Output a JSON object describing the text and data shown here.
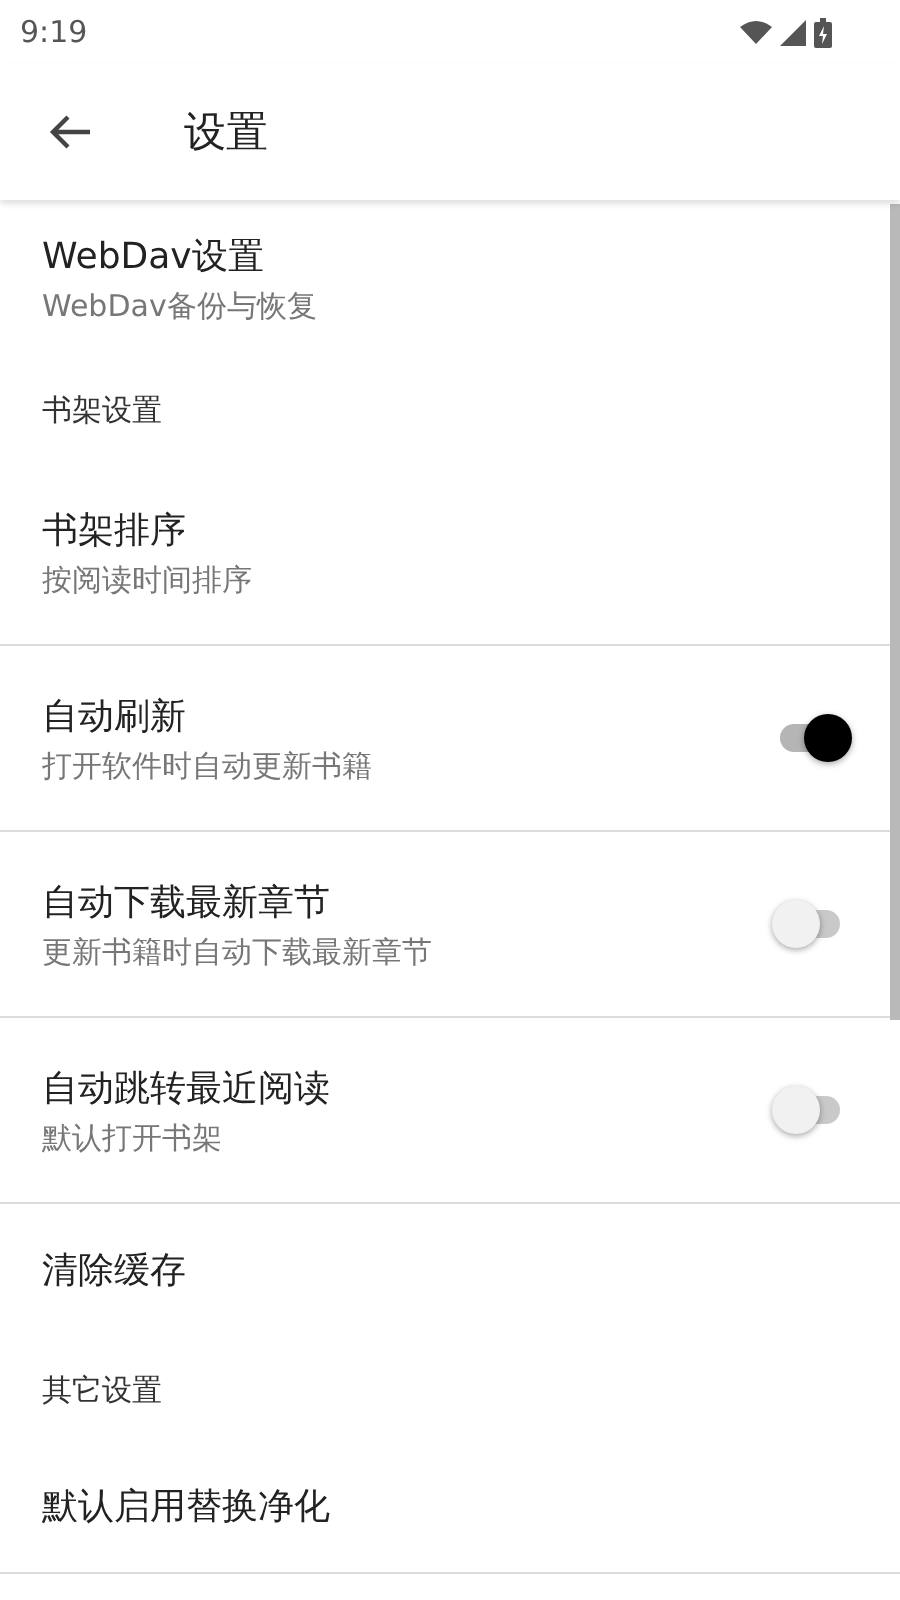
{
  "status_bar": {
    "time": "9:19"
  },
  "toolbar": {
    "title": "设置"
  },
  "items": [
    {
      "kind": "nav",
      "title": "WebDav设置",
      "summary": "WebDav备份与恢复"
    },
    {
      "kind": "header",
      "title": "书架设置"
    },
    {
      "kind": "nav",
      "title": "书架排序",
      "summary": "按阅读时间排序"
    },
    {
      "kind": "switch",
      "title": "自动刷新",
      "summary": "打开软件时自动更新书籍",
      "on": true
    },
    {
      "kind": "switch",
      "title": "自动下载最新章节",
      "summary": "更新书籍时自动下载最新章节",
      "on": false
    },
    {
      "kind": "switch",
      "title": "自动跳转最近阅读",
      "summary": "默认打开书架",
      "on": false
    },
    {
      "kind": "nav",
      "title": "清除缓存"
    },
    {
      "kind": "header",
      "title": "其它设置"
    },
    {
      "kind": "nav",
      "title": "默认启用替换净化"
    }
  ]
}
